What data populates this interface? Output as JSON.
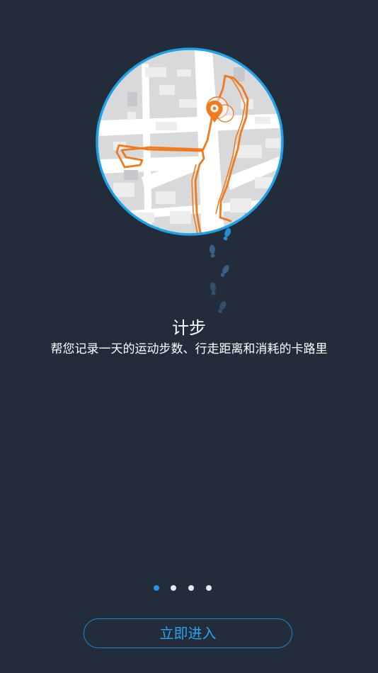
{
  "onboarding": {
    "title": "计步",
    "description": "帮您记录一天的运动步数、行走距离和消耗的卡路里",
    "page_indicator": {
      "total": 4,
      "current": 1
    },
    "enter_label": "立即进入"
  },
  "colors": {
    "background": "#222c3a",
    "accent_blue": "#1e9ae6",
    "route_orange": "#f07a1d",
    "map_ground": "#d8d9db"
  },
  "icons": {
    "illustration": "map-route-illustration",
    "pin": "location-pin-icon",
    "footprints": "footprint-icon"
  }
}
